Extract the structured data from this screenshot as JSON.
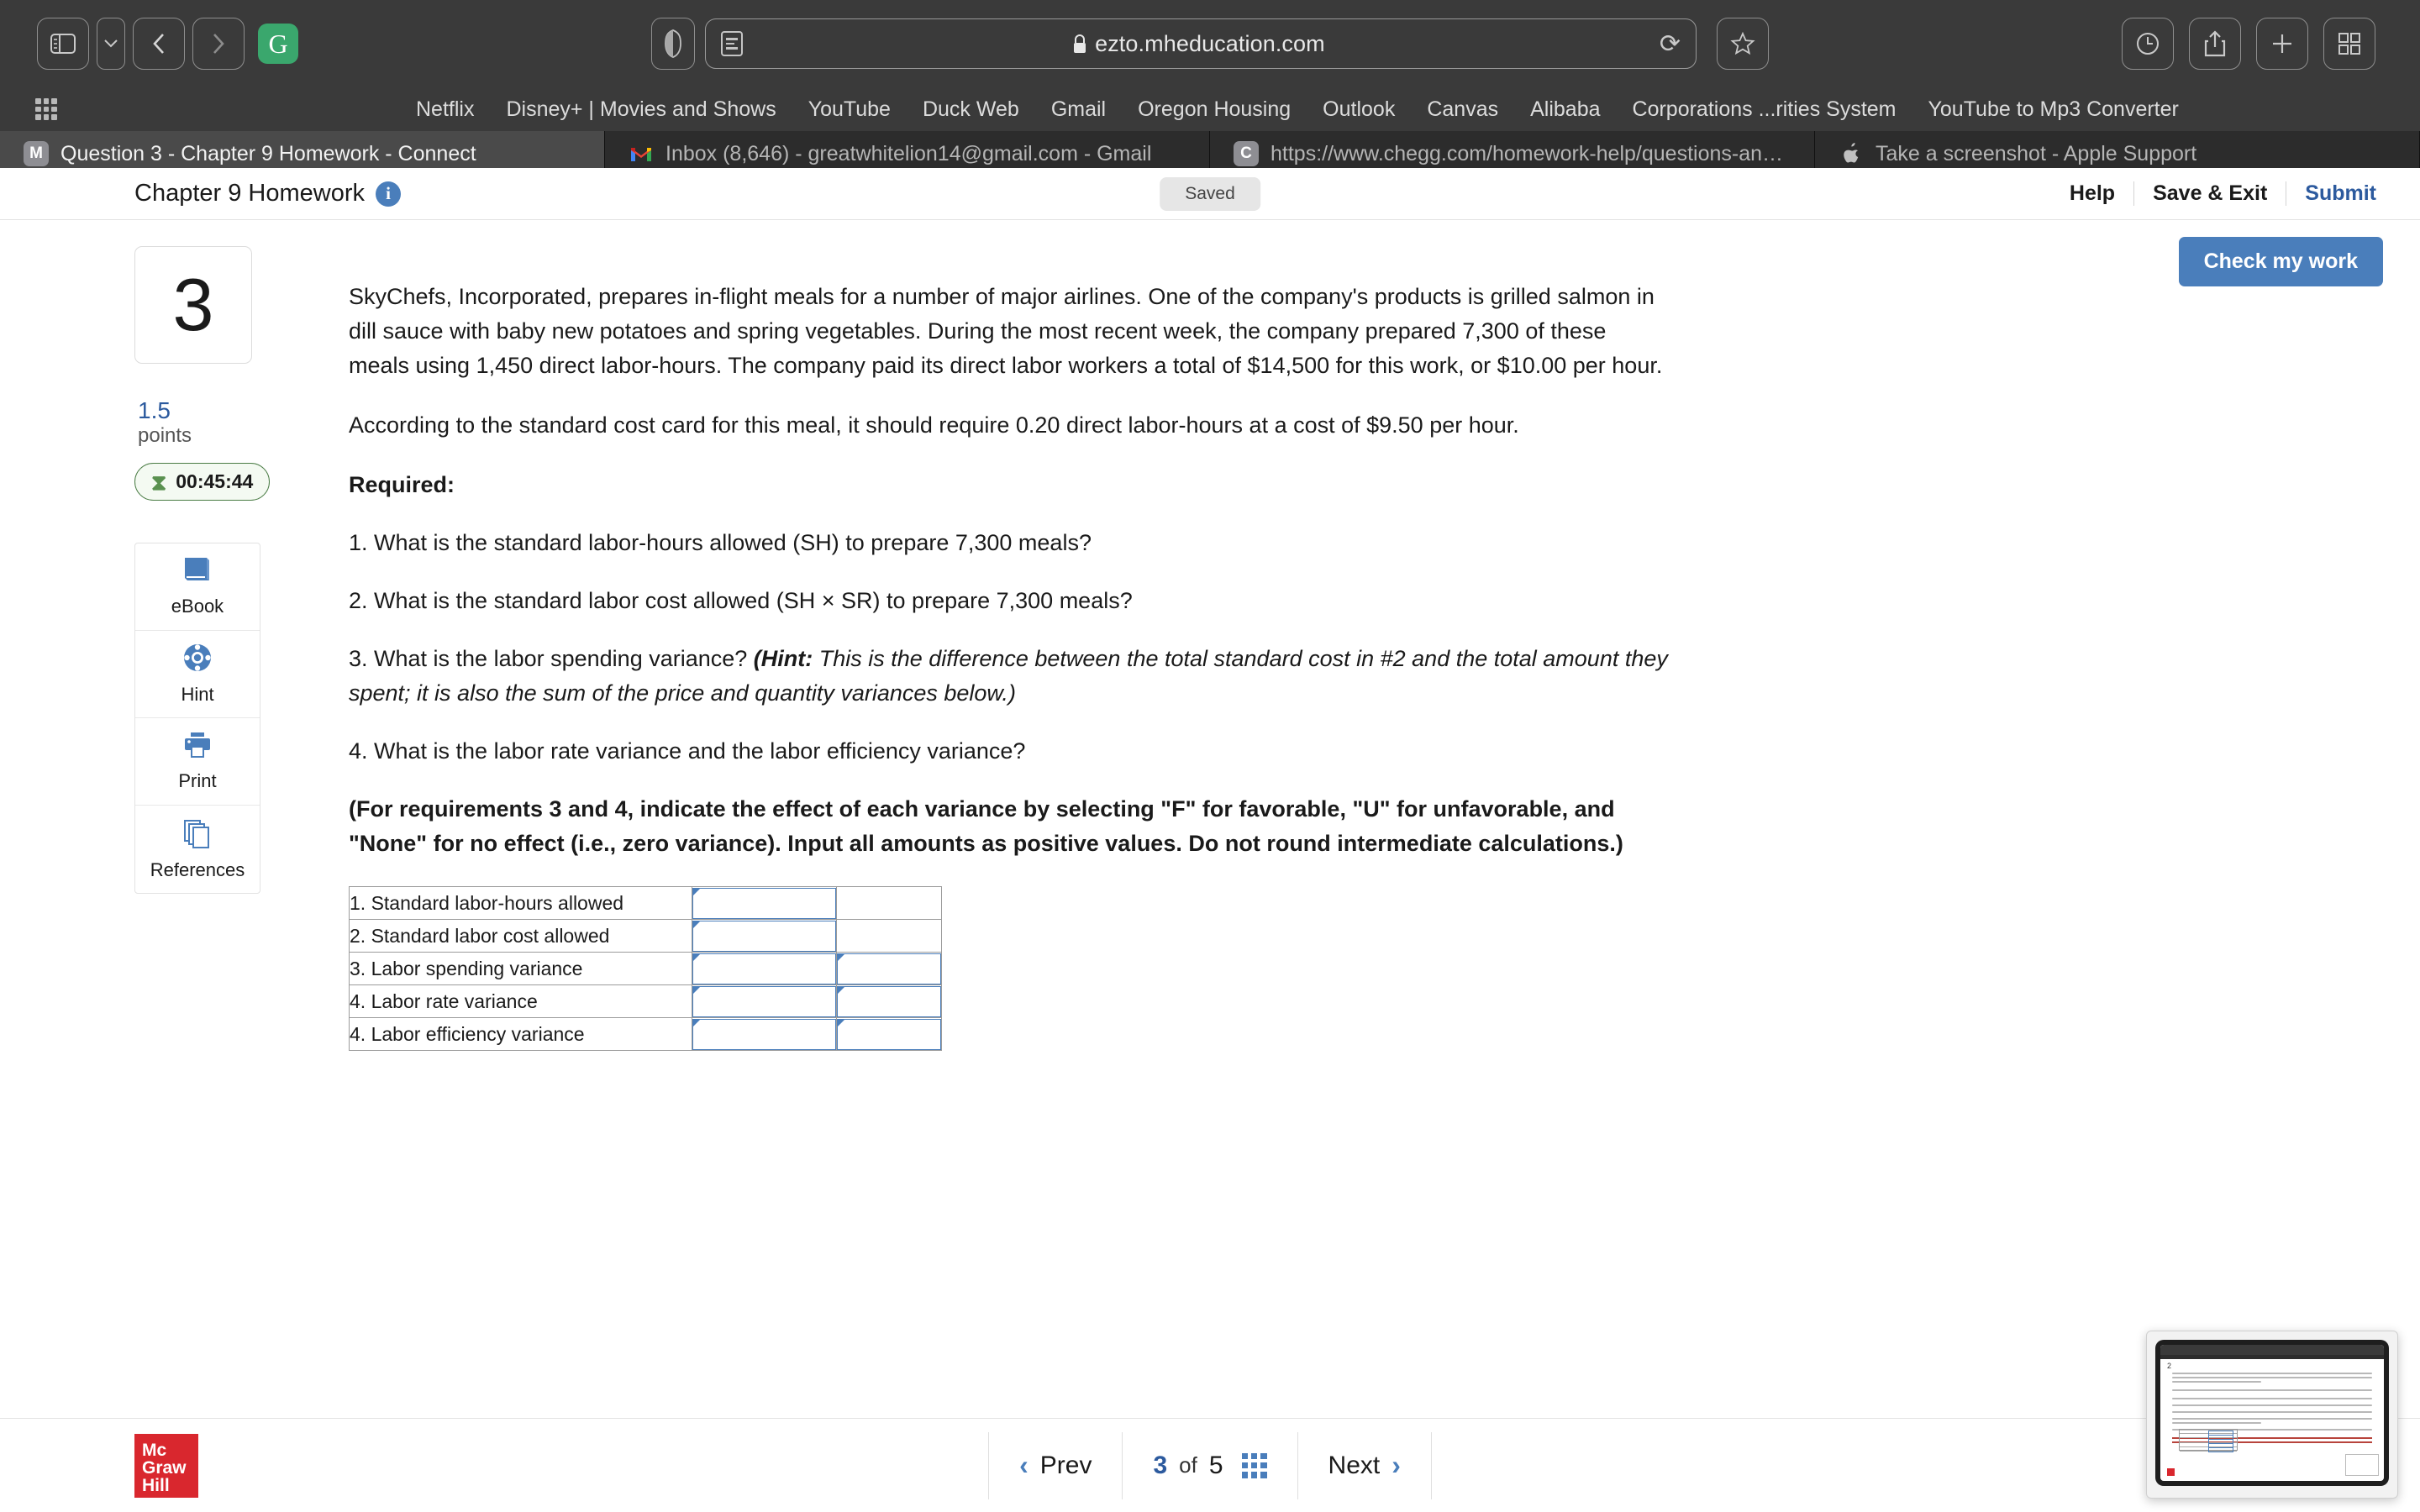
{
  "browser": {
    "url": "ezto.mheducation.com",
    "lock_icon": "lock-icon",
    "sidebar_icon": "sidebar-toggle-icon",
    "back_icon": "back-icon",
    "forward_icon": "forward-icon",
    "grammarly_label": "G",
    "shield_icon": "privacy-shield-icon",
    "reader_icon": "reader-view-icon",
    "reload_icon": "reload-icon",
    "bookmark_icon": "bookmark-star-icon",
    "history_icon": "history-clock-icon",
    "share_icon": "share-icon",
    "new_tab_icon": "plus-icon",
    "tab_overview_icon": "tab-overview-icon",
    "apps_icon": "apps-grid-icon",
    "bookmarks": [
      "Netflix",
      "Disney+ | Movies and Shows",
      "YouTube",
      "Duck Web",
      "Gmail",
      "Oregon Housing",
      "Outlook",
      "Canvas",
      "Alibaba",
      "Corporations ...rities System",
      "YouTube to Mp3 Converter"
    ],
    "tabs": [
      {
        "favicon": "M",
        "favicon_name": "mheducation-favicon",
        "label": "Question 3 - Chapter 9 Homework - Connect",
        "active": true
      },
      {
        "favicon": "M",
        "favicon_name": "gmail-favicon",
        "label": "Inbox (8,646) - greatwhitelion14@gmail.com - Gmail",
        "active": false
      },
      {
        "favicon": "C",
        "favicon_name": "chegg-favicon",
        "label": "https://www.chegg.com/homework-help/questions-and...",
        "active": false
      },
      {
        "favicon": "",
        "favicon_name": "apple-favicon",
        "label": "Take a screenshot - Apple Support",
        "active": false
      }
    ]
  },
  "header": {
    "title": "Chapter 9 Homework",
    "info_icon": "info-icon",
    "saved_status": "Saved",
    "help_label": "Help",
    "save_exit_label": "Save & Exit",
    "submit_label": "Submit",
    "check_my_work_label": "Check my work"
  },
  "sidebar": {
    "question_number": "3",
    "points_value": "1.5",
    "points_label": "points",
    "timer": "00:45:44",
    "timer_icon": "hourglass-icon",
    "tools": [
      {
        "icon": "ebook-icon",
        "label": "eBook"
      },
      {
        "icon": "life-ring-hint-icon",
        "label": "Hint"
      },
      {
        "icon": "printer-icon",
        "label": "Print"
      },
      {
        "icon": "references-pages-icon",
        "label": "References"
      }
    ]
  },
  "question": {
    "paragraph_1": "SkyChefs, Incorporated, prepares in-flight meals for a number of major airlines. One of the company's products is grilled salmon in dill sauce with baby new potatoes and spring vegetables. During the most recent week, the company prepared 7,300 of these meals using 1,450 direct labor-hours. The company paid its direct labor workers a total of $14,500 for this work, or $10.00 per hour.",
    "paragraph_2": "According to the standard cost card for this meal, it should require 0.20 direct labor-hours at a cost of $9.50 per hour.",
    "required_label": "Required:",
    "req_1": "1. What is the standard labor-hours allowed (SH) to prepare 7,300 meals?",
    "req_2": "2. What is the standard labor cost allowed (SH × SR) to prepare 7,300 meals?",
    "req_3_lead": "3. What is the labor spending variance? ",
    "req_3_hint_bold": "(Hint:",
    "req_3_hint_italic": " This is the difference between the total standard cost in #2 and the total amount they spent; it is also the sum of the price and quantity variances below.)",
    "req_4": "4. What is the labor rate variance and the labor efficiency variance?",
    "red_note": "(For requirements 3 and 4, indicate the effect of each variance by selecting \"F\" for favorable, \"U\" for unfavorable, and \"None\" for no effect (i.e., zero variance). Input all amounts as positive values. Do not round intermediate calculations.)"
  },
  "answer_table": {
    "rows": [
      {
        "label": "1. Standard labor-hours allowed",
        "value_1": "",
        "value_2": "",
        "has_second_input": false
      },
      {
        "label": "2. Standard labor cost allowed",
        "value_1": "",
        "value_2": "",
        "has_second_input": false
      },
      {
        "label": "3. Labor spending variance",
        "value_1": "",
        "value_2": "",
        "has_second_input": true
      },
      {
        "label": "4. Labor rate variance",
        "value_1": "",
        "value_2": "",
        "has_second_input": true
      },
      {
        "label": "4. Labor efficiency variance",
        "value_1": "",
        "value_2": "",
        "has_second_input": true
      }
    ]
  },
  "footer": {
    "logo_line_1": "Mc",
    "logo_line_2": "Graw",
    "logo_line_3": "Hill",
    "prev_label": "Prev",
    "current_page": "3",
    "of_label": "of",
    "total_pages": "5",
    "next_label": "Next",
    "grid_icon": "question-grid-icon",
    "prev_icon": "chevron-left-icon",
    "next_icon": "chevron-right-icon"
  },
  "pip": {
    "name": "picture-in-picture-preview",
    "preview_question_number": "2"
  },
  "colors": {
    "accent_blue": "#4a7ebb",
    "link_blue": "#2c5a9e",
    "warning_red": "#9e2a23",
    "brand_red": "#d9272e",
    "timer_green": "#4a7c45"
  }
}
